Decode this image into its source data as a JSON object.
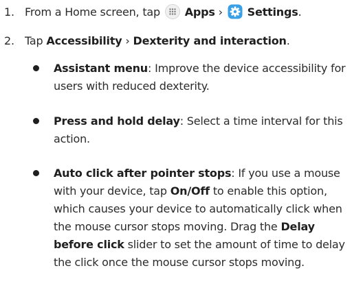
{
  "steps": [
    {
      "number": "1.",
      "text_a": "From a Home screen, tap",
      "apps_label": "Apps",
      "separator": "›",
      "settings_label": "Settings",
      "end": "."
    },
    {
      "number": "2.",
      "text_a": "Tap",
      "accessibility_label": "Accessibility",
      "separator": "›",
      "dexterity_label": "Dexterity and interaction",
      "end": "."
    }
  ],
  "bullets": [
    {
      "title": "Assistant menu",
      "text": ": Improve the device accessibility for users with reduced dexterity."
    },
    {
      "title": "Press and hold delay",
      "text": ": Select a time interval for this action."
    },
    {
      "title": "Auto click after pointer stops",
      "text_a": ": If you use a mouse with your device, tap",
      "onoff": "On/Off",
      "text_b": "to enable this option, which causes your device to automatically click when the mouse cursor stops moving. Drag the",
      "delay": "Delay before click",
      "text_c": "slider to set the amount of time to delay the click once the mouse cursor stops moving."
    }
  ],
  "icons": {
    "apps": "apps-grid-icon",
    "settings": "settings-gear-icon",
    "settings_color": "#3aa0e6"
  }
}
